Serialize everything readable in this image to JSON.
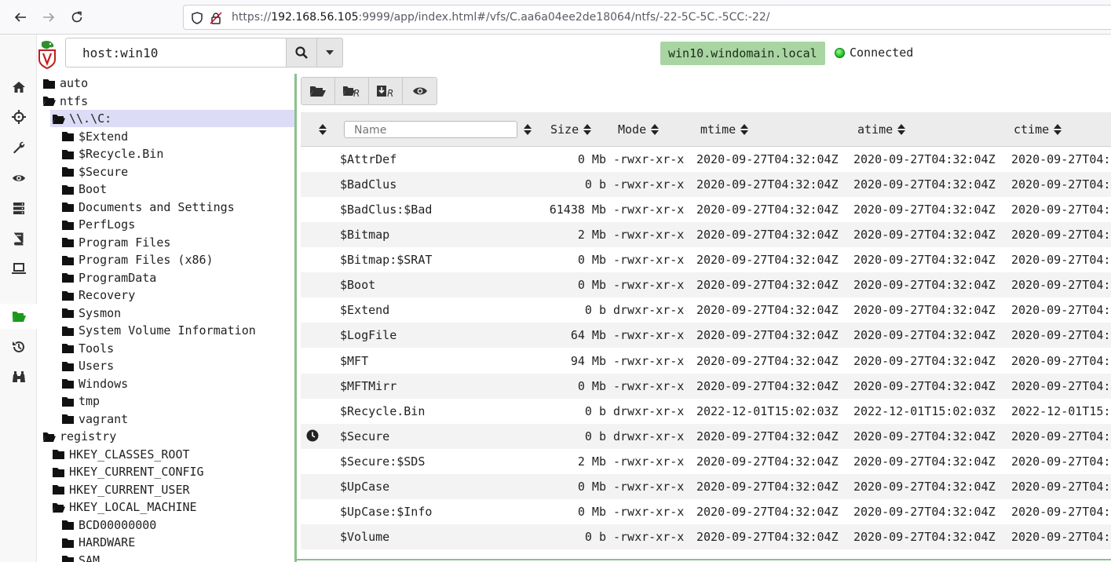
{
  "browser": {
    "url_prefix": "https://",
    "url_host": "192.168.56.105",
    "url_rest": ":9999/app/index.html#/vfs/C.aa6a04ee2de18064/ntfs/-22-5C-5C.-5CC:-22/"
  },
  "search": {
    "value": "host:win10"
  },
  "client": {
    "hostname": "win10.windomain.local",
    "status": "Connected"
  },
  "tree": [
    {
      "label": "auto",
      "indent": 0,
      "open": false
    },
    {
      "label": "ntfs",
      "indent": 0,
      "open": true
    },
    {
      "label": "\\\\.\\C:",
      "indent": 1,
      "open": true,
      "selected": true
    },
    {
      "label": "$Extend",
      "indent": 2,
      "open": false
    },
    {
      "label": "$Recycle.Bin",
      "indent": 2,
      "open": false
    },
    {
      "label": "$Secure",
      "indent": 2,
      "open": false
    },
    {
      "label": "Boot",
      "indent": 2,
      "open": false
    },
    {
      "label": "Documents and Settings",
      "indent": 2,
      "open": false
    },
    {
      "label": "PerfLogs",
      "indent": 2,
      "open": false
    },
    {
      "label": "Program Files",
      "indent": 2,
      "open": false
    },
    {
      "label": "Program Files (x86)",
      "indent": 2,
      "open": false
    },
    {
      "label": "ProgramData",
      "indent": 2,
      "open": false
    },
    {
      "label": "Recovery",
      "indent": 2,
      "open": false
    },
    {
      "label": "Sysmon",
      "indent": 2,
      "open": false
    },
    {
      "label": "System Volume Information",
      "indent": 2,
      "open": false
    },
    {
      "label": "Tools",
      "indent": 2,
      "open": false
    },
    {
      "label": "Users",
      "indent": 2,
      "open": false
    },
    {
      "label": "Windows",
      "indent": 2,
      "open": false
    },
    {
      "label": "tmp",
      "indent": 2,
      "open": false
    },
    {
      "label": "vagrant",
      "indent": 2,
      "open": false
    },
    {
      "label": "registry",
      "indent": 0,
      "open": true
    },
    {
      "label": "HKEY_CLASSES_ROOT",
      "indent": 1,
      "open": false
    },
    {
      "label": "HKEY_CURRENT_CONFIG",
      "indent": 1,
      "open": false
    },
    {
      "label": "HKEY_CURRENT_USER",
      "indent": 1,
      "open": false
    },
    {
      "label": "HKEY_LOCAL_MACHINE",
      "indent": 1,
      "open": true
    },
    {
      "label": "BCD00000000",
      "indent": 2,
      "open": false
    },
    {
      "label": "HARDWARE",
      "indent": 2,
      "open": false
    },
    {
      "label": "SAM",
      "indent": 2,
      "open": false
    }
  ],
  "table": {
    "filter_placeholder": "Name",
    "columns": {
      "size": "Size",
      "mode": "Mode",
      "mtime": "mtime",
      "atime": "atime",
      "ctime": "ctime"
    },
    "rows": [
      {
        "name": "$AttrDef",
        "size": "0 Mb",
        "mode": "-rwxr-xr-x",
        "mtime": "2020-09-27T04:32:04Z",
        "atime": "2020-09-27T04:32:04Z",
        "ctime": "2020-09-27T04:",
        "history": false
      },
      {
        "name": "$BadClus",
        "size": "0 b",
        "mode": "-rwxr-xr-x",
        "mtime": "2020-09-27T04:32:04Z",
        "atime": "2020-09-27T04:32:04Z",
        "ctime": "2020-09-27T04:",
        "history": false
      },
      {
        "name": "$BadClus:$Bad",
        "size": "61438 Mb",
        "mode": "-rwxr-xr-x",
        "mtime": "2020-09-27T04:32:04Z",
        "atime": "2020-09-27T04:32:04Z",
        "ctime": "2020-09-27T04:",
        "history": false
      },
      {
        "name": "$Bitmap",
        "size": "2 Mb",
        "mode": "-rwxr-xr-x",
        "mtime": "2020-09-27T04:32:04Z",
        "atime": "2020-09-27T04:32:04Z",
        "ctime": "2020-09-27T04:",
        "history": false
      },
      {
        "name": "$Bitmap:$SRAT",
        "size": "0 Mb",
        "mode": "-rwxr-xr-x",
        "mtime": "2020-09-27T04:32:04Z",
        "atime": "2020-09-27T04:32:04Z",
        "ctime": "2020-09-27T04:",
        "history": false
      },
      {
        "name": "$Boot",
        "size": "0 Mb",
        "mode": "-rwxr-xr-x",
        "mtime": "2020-09-27T04:32:04Z",
        "atime": "2020-09-27T04:32:04Z",
        "ctime": "2020-09-27T04:",
        "history": false
      },
      {
        "name": "$Extend",
        "size": "0 b",
        "mode": "drwxr-xr-x",
        "mtime": "2020-09-27T04:32:04Z",
        "atime": "2020-09-27T04:32:04Z",
        "ctime": "2020-09-27T04:",
        "history": false
      },
      {
        "name": "$LogFile",
        "size": "64 Mb",
        "mode": "-rwxr-xr-x",
        "mtime": "2020-09-27T04:32:04Z",
        "atime": "2020-09-27T04:32:04Z",
        "ctime": "2020-09-27T04:",
        "history": false
      },
      {
        "name": "$MFT",
        "size": "94 Mb",
        "mode": "-rwxr-xr-x",
        "mtime": "2020-09-27T04:32:04Z",
        "atime": "2020-09-27T04:32:04Z",
        "ctime": "2020-09-27T04:",
        "history": false
      },
      {
        "name": "$MFTMirr",
        "size": "0 Mb",
        "mode": "-rwxr-xr-x",
        "mtime": "2020-09-27T04:32:04Z",
        "atime": "2020-09-27T04:32:04Z",
        "ctime": "2020-09-27T04:",
        "history": false
      },
      {
        "name": "$Recycle.Bin",
        "size": "0 b",
        "mode": "drwxr-xr-x",
        "mtime": "2022-12-01T15:02:03Z",
        "atime": "2022-12-01T15:02:03Z",
        "ctime": "2022-12-01T15:",
        "history": false
      },
      {
        "name": "$Secure",
        "size": "0 b",
        "mode": "drwxr-xr-x",
        "mtime": "2020-09-27T04:32:04Z",
        "atime": "2020-09-27T04:32:04Z",
        "ctime": "2020-09-27T04:",
        "history": true
      },
      {
        "name": "$Secure:$SDS",
        "size": "2 Mb",
        "mode": "-rwxr-xr-x",
        "mtime": "2020-09-27T04:32:04Z",
        "atime": "2020-09-27T04:32:04Z",
        "ctime": "2020-09-27T04:",
        "history": false
      },
      {
        "name": "$UpCase",
        "size": "0 Mb",
        "mode": "-rwxr-xr-x",
        "mtime": "2020-09-27T04:32:04Z",
        "atime": "2020-09-27T04:32:04Z",
        "ctime": "2020-09-27T04:",
        "history": false
      },
      {
        "name": "$UpCase:$Info",
        "size": "0 Mb",
        "mode": "-rwxr-xr-x",
        "mtime": "2020-09-27T04:32:04Z",
        "atime": "2020-09-27T04:32:04Z",
        "ctime": "2020-09-27T04:",
        "history": false
      },
      {
        "name": "$Volume",
        "size": "0 b",
        "mode": "-rwxr-xr-x",
        "mtime": "2020-09-27T04:32:04Z",
        "atime": "2020-09-27T04:32:04Z",
        "ctime": "2020-09-27T04:",
        "history": false
      }
    ]
  }
}
